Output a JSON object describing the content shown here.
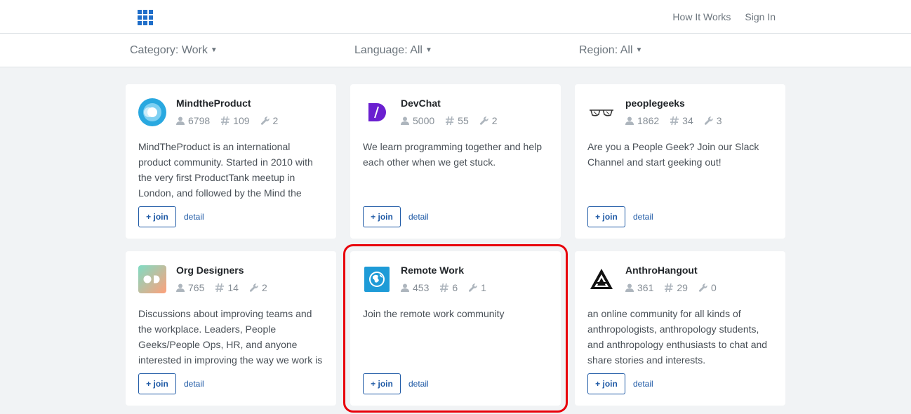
{
  "nav": {
    "how_it_works": "How It Works",
    "sign_in": "Sign In"
  },
  "filters": {
    "category": "Category: Work",
    "language": "Language: All",
    "region": "Region: All"
  },
  "cards": [
    {
      "title": "MindtheProduct",
      "members": "6798",
      "channels": "109",
      "integrations": "2",
      "description": "MindTheProduct is an international product community. Started in 2010 with the very first ProductTank meetup in London, and followed by the Mind the",
      "join_label": "+ join",
      "detail_label": "detail",
      "icon": "mindtheproduct-logo"
    },
    {
      "title": "DevChat",
      "members": "5000",
      "channels": "55",
      "integrations": "2",
      "description": "We learn programming together and help each other when we get stuck.",
      "join_label": "+ join",
      "detail_label": "detail",
      "icon": "devchat-logo"
    },
    {
      "title": "peoplegeeks",
      "members": "1862",
      "channels": "34",
      "integrations": "3",
      "description": "Are you a People Geek? Join our Slack Channel and start geeking out!",
      "join_label": "+ join",
      "detail_label": "detail",
      "icon": "glasses-logo"
    },
    {
      "title": "Org Designers",
      "members": "765",
      "channels": "14",
      "integrations": "2",
      "description": "Discussions about improving teams and the workplace. Leaders, People Geeks/People Ops, HR, and anyone interested in improving the way we work is",
      "join_label": "+ join",
      "detail_label": "detail",
      "icon": "orgdesigners-logo"
    },
    {
      "title": "Remote Work",
      "members": "453",
      "channels": "6",
      "integrations": "1",
      "description": "Join the remote work community",
      "join_label": "+ join",
      "detail_label": "detail",
      "icon": "globe-logo"
    },
    {
      "title": "AnthroHangout",
      "members": "361",
      "channels": "29",
      "integrations": "0",
      "description": "an online community for all kinds of anthropologists, anthropology students, and anthropology enthusiasts to chat and share stories and interests.",
      "join_label": "+ join",
      "detail_label": "detail",
      "icon": "anthrohangout-logo"
    }
  ],
  "colors": {
    "accent": "#1f5aa6",
    "highlight": "#e8000b",
    "logo": "#1f6ec9"
  }
}
